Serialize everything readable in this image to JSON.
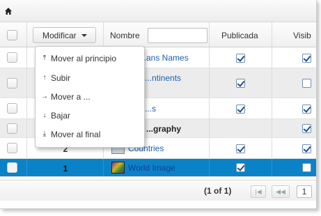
{
  "toolbar": {
    "home_icon": "home-icon"
  },
  "header": {
    "modify_button_label": "Modificar",
    "name_label": "Nombre",
    "search_value": "",
    "published_label": "Publicada",
    "visible_label": "Visib"
  },
  "menu": {
    "items": [
      {
        "label": "Mover al principio",
        "icon": "move-to-top-icon"
      },
      {
        "label": "Subir",
        "icon": "arrow-up-icon"
      },
      {
        "label": "Mover a ...",
        "icon": "arrow-right-icon"
      },
      {
        "label": "Bajar",
        "icon": "arrow-down-icon"
      },
      {
        "label": "Mover al final",
        "icon": "move-to-bottom-icon"
      }
    ]
  },
  "rows": [
    {
      "order": "",
      "name": "...ans Names",
      "published": true,
      "visible": true
    },
    {
      "order": "",
      "name": "...ntinents",
      "published": true,
      "visible": false
    },
    {
      "order": "",
      "name": "...s",
      "published": true,
      "visible": true
    },
    {
      "order": "",
      "name": "...graphy",
      "published": null,
      "visible": true
    },
    {
      "order": "2",
      "name": "Countries",
      "published": true,
      "visible": true
    },
    {
      "order": "1",
      "name": "World Image",
      "published": true,
      "visible": false
    }
  ],
  "footer": {
    "page_info": "(1 of 1)",
    "current_page": "1"
  },
  "colors": {
    "selected_row": "#0a82c8",
    "link": "#1a5fb4"
  }
}
